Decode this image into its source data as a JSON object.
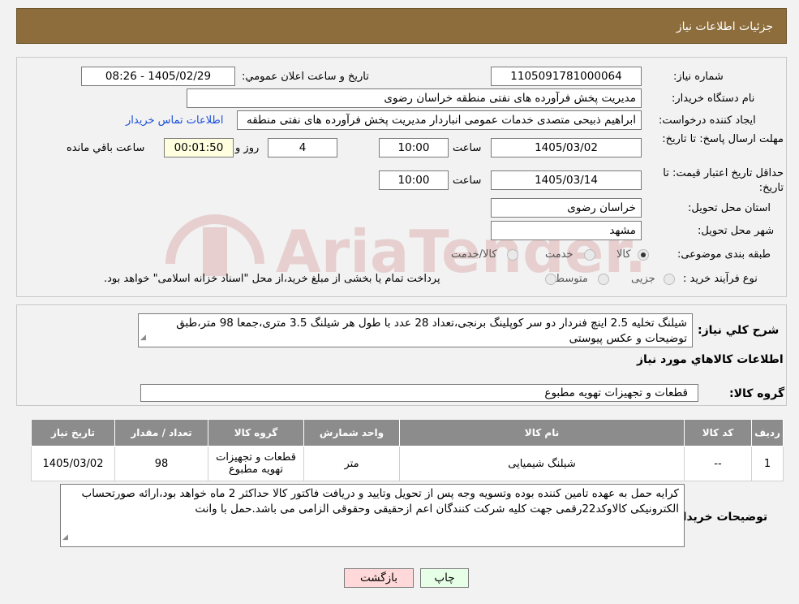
{
  "header": {
    "title": "جزئیات اطلاعات نیاز"
  },
  "form": {
    "need_number_label": "شماره نیاز:",
    "need_number": "1105091781000064",
    "announce_label": "تاریخ و ساعت اعلان عمومي:",
    "announce_value": "1405/02/29 - 08:26",
    "buyer_label": "نام دستگاه خريدار:",
    "buyer_value": "مدیریت پخش فرآورده های نفتی منطقه خراسان رضوی",
    "creator_label": "ايجاد كننده درخواست:",
    "creator_value": "ابراهیم ذبیحی متصدی خدمات عمومی انباردار مدیریت پخش فرآورده های نفتی منطقه",
    "contact_link": "اطلاعات تماس خريدار",
    "deadline_label": "مهلت ارسال پاسخ: تا تاريخ:",
    "deadline_date": "1405/03/02",
    "time_label": "ساعت",
    "deadline_time": "10:00",
    "days_value": "4",
    "days_label": "روز و",
    "remaining_value": "00:01:50",
    "remaining_label": "ساعت باقي مانده",
    "validity_label": "حداقل تاريخ اعتبار قيمت: تا تاريخ:",
    "validity_date": "1405/03/14",
    "validity_time": "10:00",
    "province_label": "استان محل تحويل:",
    "province_value": "خراسان رضوی",
    "city_label": "شهر محل تحويل:",
    "city_value": "مشهد",
    "category_label": "طبقه بندی موضوعی:",
    "category_options": [
      "کالا",
      "خدمت",
      "کالا/خدمت"
    ],
    "process_label": "نوع فرآیند خرید :",
    "process_options": [
      "جزیی",
      "متوسط"
    ],
    "process_note": "پرداخت تمام یا بخشی از مبلغ خرید،از محل \"اسناد خزانه اسلامی\" خواهد بود."
  },
  "description": {
    "label": "شرح كلي نياز:",
    "text": "شیلنگ تخلیه 2.5 اینچ فنردار دو سر کوپلینگ برنجی،تعداد 28 عدد با طول هر شیلنگ 3.5 متری،جمعا 98 متر،طبق توضیحات و عکس پیوستی",
    "items_title": "اطلاعات كالاهاي مورد نياز",
    "group_label": "گروه كالا:",
    "group_value": "قطعات و تجهیزات تهویه مطبوع"
  },
  "table": {
    "headers": [
      "رديف",
      "كد كالا",
      "نام كالا",
      "واحد شمارش",
      "گروه كالا",
      "تعداد / مقدار",
      "تاريخ نياز"
    ],
    "rows": [
      [
        "1",
        "--",
        "شیلنگ شیمیایی",
        "متر",
        "قطعات و تجهیزات تهویه مطبوع",
        "98",
        "1405/03/02"
      ]
    ]
  },
  "notes": {
    "label": "توضيحات خريدار:",
    "text": "کرایه حمل به عهده تامین کننده بوده وتسویه وجه پس از تحویل وتایید و دریافت فاکتور کالا حداکثر 2 ماه خواهد بود،ارائه صورتحساب الکترونیکی کالاوکد22رقمی جهت کلیه شرکت کنندگان اعم ازحقیقی وحقوقی الزامی می باشد.حمل با وانت"
  },
  "buttons": {
    "print": "چاپ",
    "back": "بازگشت"
  },
  "watermark": {
    "text": "AriaTender.neT"
  },
  "colors": {
    "header_bg": "#8c6d3b",
    "table_header_bg": "#8c8c8c",
    "link": "#1b4fd8",
    "back_bg": "#ffd9d9",
    "print_bg": "#e6ffe6"
  }
}
